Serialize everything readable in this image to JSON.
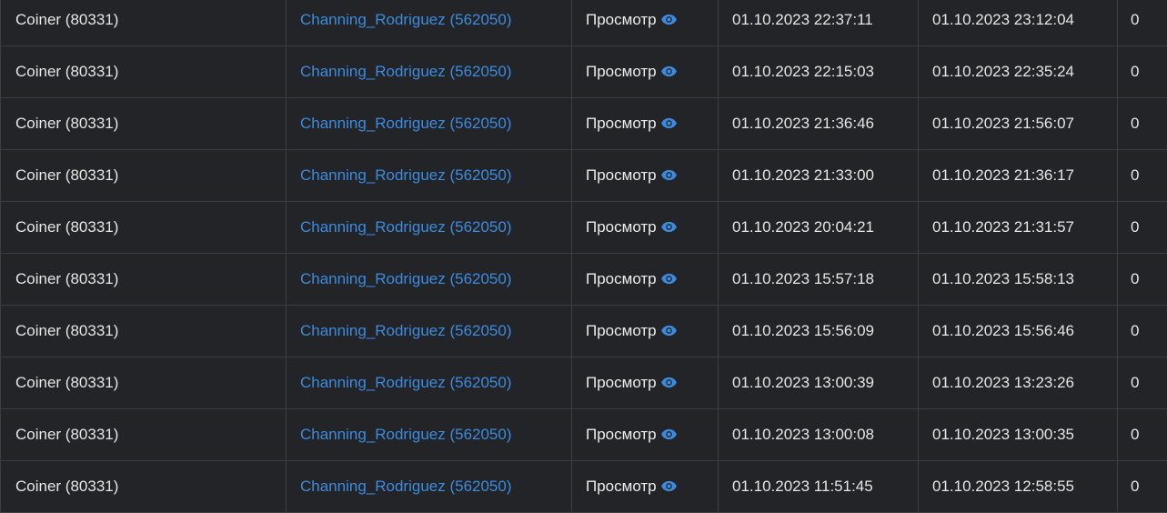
{
  "colors": {
    "background": "#222428",
    "border": "#3a3d43",
    "text": "#e6e6e6",
    "link": "#3d8bde"
  },
  "view_icon": "eye-icon",
  "rows": [
    {
      "owner": "Coiner (80331)",
      "user": "Channing_Rodriguez (562050)",
      "view": "Просмотр",
      "start": "01.10.2023 22:37:11",
      "end": "01.10.2023 23:12:04",
      "count": "0"
    },
    {
      "owner": "Coiner (80331)",
      "user": "Channing_Rodriguez (562050)",
      "view": "Просмотр",
      "start": "01.10.2023 22:15:03",
      "end": "01.10.2023 22:35:24",
      "count": "0"
    },
    {
      "owner": "Coiner (80331)",
      "user": "Channing_Rodriguez (562050)",
      "view": "Просмотр",
      "start": "01.10.2023 21:36:46",
      "end": "01.10.2023 21:56:07",
      "count": "0"
    },
    {
      "owner": "Coiner (80331)",
      "user": "Channing_Rodriguez (562050)",
      "view": "Просмотр",
      "start": "01.10.2023 21:33:00",
      "end": "01.10.2023 21:36:17",
      "count": "0"
    },
    {
      "owner": "Coiner (80331)",
      "user": "Channing_Rodriguez (562050)",
      "view": "Просмотр",
      "start": "01.10.2023 20:04:21",
      "end": "01.10.2023 21:31:57",
      "count": "0"
    },
    {
      "owner": "Coiner (80331)",
      "user": "Channing_Rodriguez (562050)",
      "view": "Просмотр",
      "start": "01.10.2023 15:57:18",
      "end": "01.10.2023 15:58:13",
      "count": "0"
    },
    {
      "owner": "Coiner (80331)",
      "user": "Channing_Rodriguez (562050)",
      "view": "Просмотр",
      "start": "01.10.2023 15:56:09",
      "end": "01.10.2023 15:56:46",
      "count": "0"
    },
    {
      "owner": "Coiner (80331)",
      "user": "Channing_Rodriguez (562050)",
      "view": "Просмотр",
      "start": "01.10.2023 13:00:39",
      "end": "01.10.2023 13:23:26",
      "count": "0"
    },
    {
      "owner": "Coiner (80331)",
      "user": "Channing_Rodriguez (562050)",
      "view": "Просмотр",
      "start": "01.10.2023 13:00:08",
      "end": "01.10.2023 13:00:35",
      "count": "0"
    },
    {
      "owner": "Coiner (80331)",
      "user": "Channing_Rodriguez (562050)",
      "view": "Просмотр",
      "start": "01.10.2023 11:51:45",
      "end": "01.10.2023 12:58:55",
      "count": "0"
    }
  ]
}
